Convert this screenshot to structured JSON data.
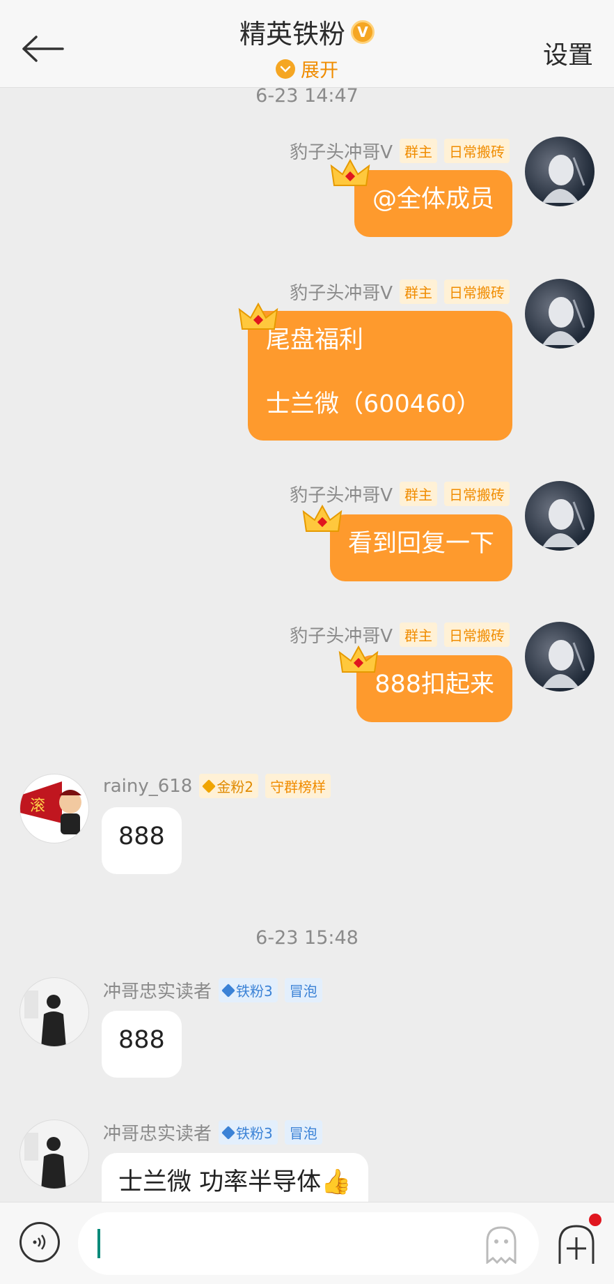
{
  "header": {
    "title": "精英铁粉",
    "v_badge": "V",
    "expand_label": "展开",
    "settings_label": "设置"
  },
  "timestamps": [
    "6-23 14:47",
    "6-23 15:48"
  ],
  "owner": {
    "name": "豹子头冲哥V",
    "tag_owner": "群主",
    "tag_daily": "日常搬砖"
  },
  "messages": [
    {
      "text": "@全体成员"
    },
    {
      "line1": "尾盘福利",
      "line2": "士兰微（600460）"
    },
    {
      "text": "看到回复一下"
    },
    {
      "text": "888扣起来"
    }
  ],
  "rainy": {
    "name": "rainy_618",
    "tag_fan": "金粉2",
    "tag_guard": "守群榜样",
    "avatar_text": "滚",
    "message": "888"
  },
  "reader": {
    "name": "冲哥忠实读者",
    "tag_fan": "铁粉3",
    "tag_bubble": "冒泡",
    "message1": "888",
    "message2": "士兰微 功率半导体👍"
  },
  "colors": {
    "accent": "#fe9a2d",
    "brand": "#f5a623",
    "iron_blue": "#3b82d6"
  }
}
